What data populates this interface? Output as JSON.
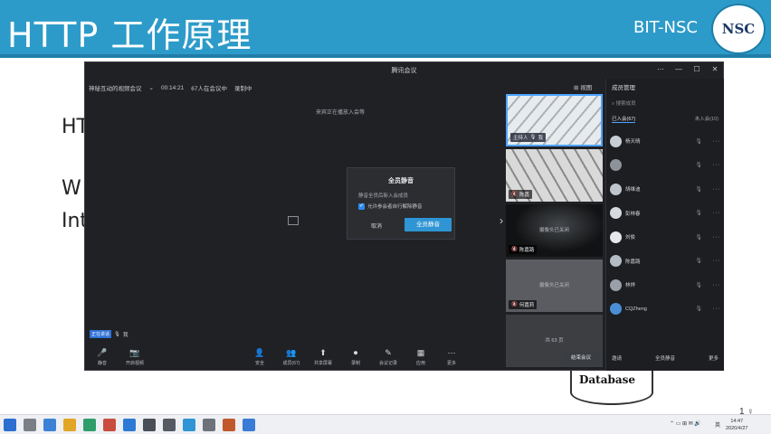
{
  "slide": {
    "title": "HTTP 工作原理",
    "brand": "BIT-NSC",
    "logo_text": "NSC",
    "text_lines": [
      "HT",
      "W",
      "Int"
    ],
    "database_label": "Database",
    "page_number": "1 ♀"
  },
  "meeting": {
    "window_title": "腾讯会议",
    "meeting_name": "神秘互动的视频会议",
    "duration": "00:14:21",
    "participants_info": "67人在会议中",
    "recording": "录制中",
    "view_button": "视图",
    "notice": "来宾正在播放入会等",
    "share_caption": "",
    "dialog": {
      "title": "全员静音",
      "description": "静音全员后新入会成员",
      "checkbox_label": "允许参会者自行解除静音",
      "cancel": "取消",
      "confirm": "全员静音"
    },
    "speaking_chip": "正在讲话",
    "speaking_name": "我"
  },
  "tiles": [
    {
      "tag": "主持人",
      "name": "我"
    },
    {
      "name": "陈嘉"
    },
    {
      "center": "摄像头已关闭",
      "name": "陈嘉路"
    },
    {
      "center": "摄像头已关闭",
      "name": "何嘉莉"
    },
    {
      "center": "共 63 页"
    }
  ],
  "panel": {
    "title": "成员管理",
    "search_placeholder": "搜索成员",
    "tabs": [
      "已入会(67)",
      "未入会(10)"
    ],
    "participants": [
      "杨天晴",
      "",
      "胡维迪",
      "彭林春",
      "刘俊",
      "陈嘉路",
      "林烨",
      "CQZheng"
    ],
    "footer": [
      "邀请",
      "全员静音",
      "更多"
    ]
  },
  "toolbar": {
    "items": [
      {
        "icon": "🎤",
        "label": "静音"
      },
      {
        "icon": "📷",
        "label": "开启视频"
      },
      {
        "icon": "👤",
        "label": "安全"
      },
      {
        "icon": "👥",
        "label": "成员(67)"
      },
      {
        "icon": "⬆",
        "label": "共享屏幕"
      },
      {
        "icon": "⏺",
        "label": "录制"
      },
      {
        "icon": "✎",
        "label": "会议记录"
      },
      {
        "icon": "▦",
        "label": "应用"
      },
      {
        "icon": "⋯",
        "label": "更多"
      }
    ],
    "end_button": "结束会议"
  },
  "taskbar": {
    "clock_time": "14:47",
    "clock_date": "2020/4/27",
    "tray_lang": "英"
  },
  "colors": {
    "header_blue": "#2d9bc9",
    "accent_blue": "#2f95d4",
    "meeting_bg": "#1f2125"
  }
}
